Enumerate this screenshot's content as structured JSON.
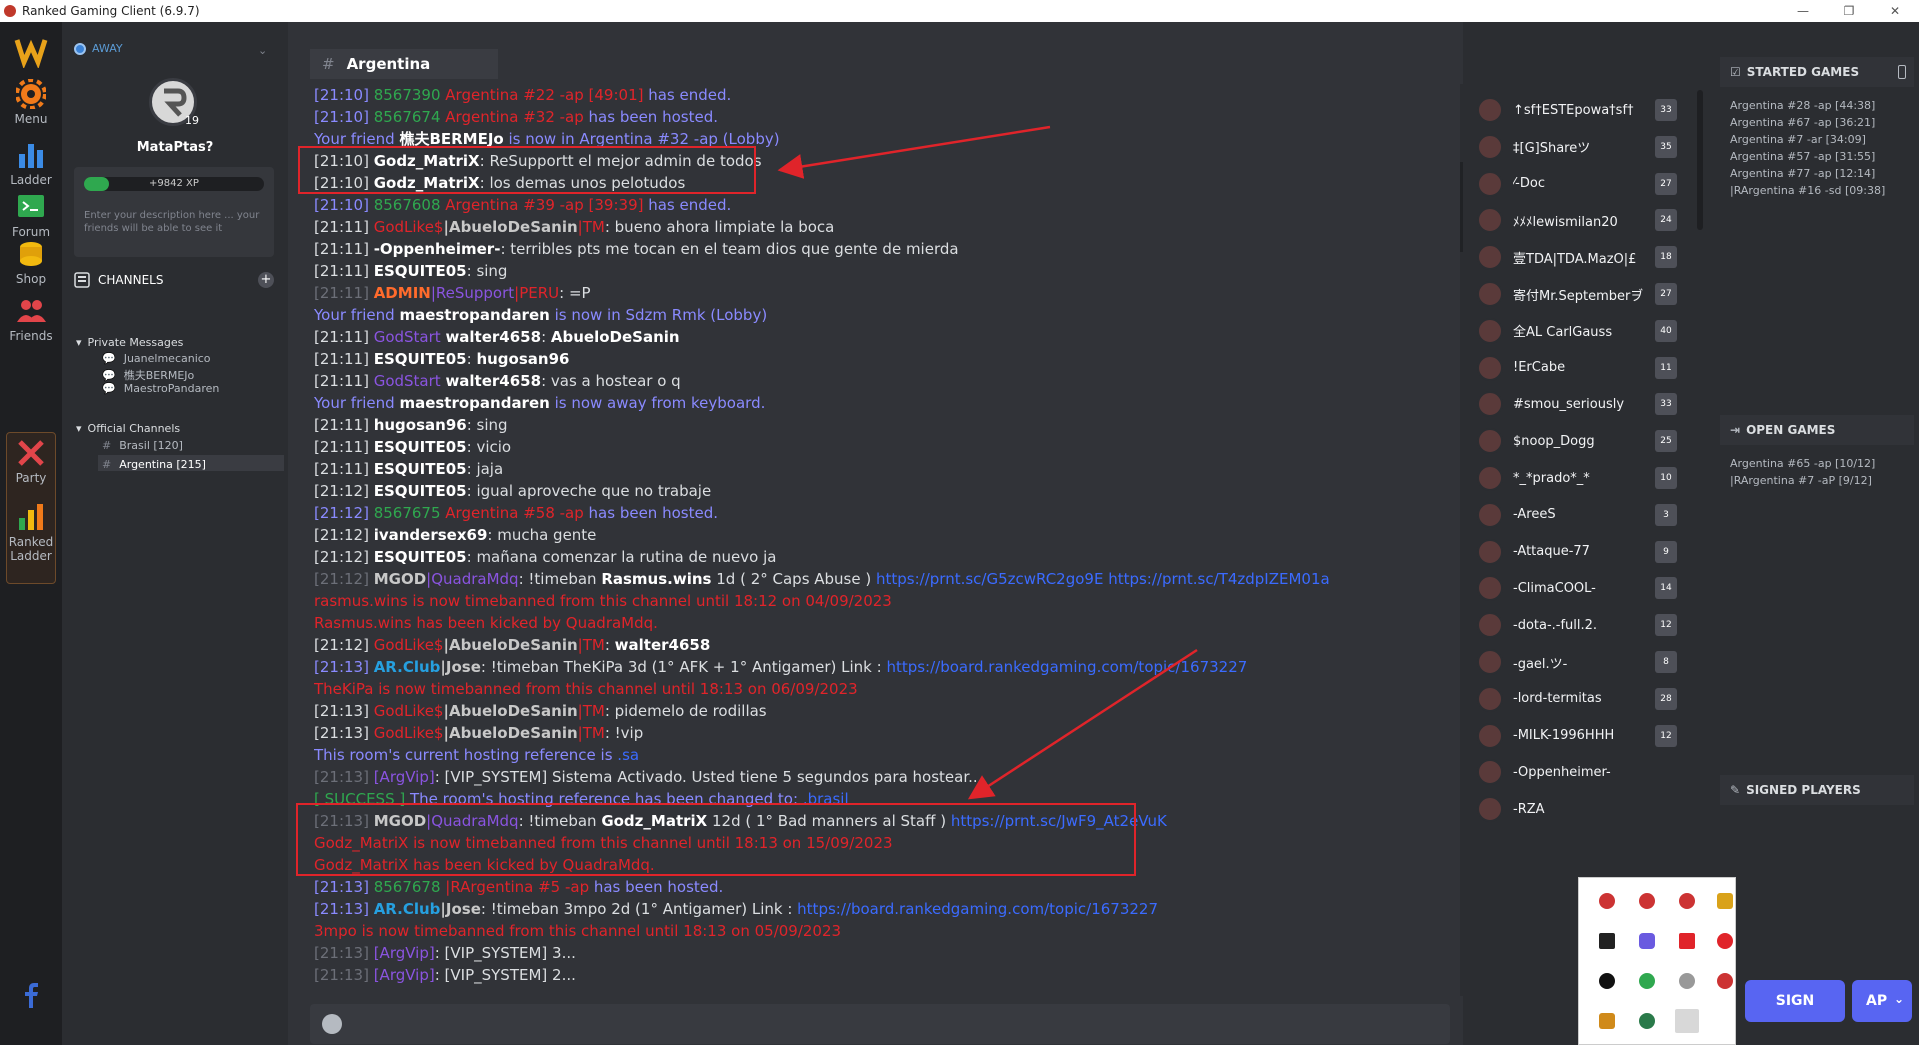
{
  "window": {
    "title": "Ranked Gaming Client (6.9.7)",
    "min": "—",
    "max": "❐",
    "close": "✕"
  },
  "rail": {
    "menu": "Menu",
    "ladder": "Ladder",
    "forum": "Forum",
    "shop": "Shop",
    "friends": "Friends",
    "party": "Party",
    "ranked_ladder_1": "Ranked",
    "ranked_ladder_2": "Ladder"
  },
  "profile": {
    "status": "AWAY",
    "level": "19",
    "username": "MataPtas?",
    "xp": "+9842 XP",
    "xp_fraction": 0.14,
    "description_placeholder": "Enter your description here ... your friends will be able to see it"
  },
  "channels": {
    "header": "CHANNELS",
    "private_group": "Private Messages",
    "private": [
      "Juanelmecanico",
      "樵夫BERMEJo",
      "MaestroPandaren"
    ],
    "official_group": "Official Channels",
    "official": [
      "Brasil [120]",
      "Argentina [215]"
    ]
  },
  "chat": {
    "channel": "Argentina",
    "messages": [
      [
        {
          "c": "blue",
          "t": "[21:10] "
        },
        {
          "c": "green",
          "t": "8567390 "
        },
        {
          "c": "red",
          "t": "Argentina #22 -ap [49:01]"
        },
        {
          "c": "blue",
          "t": " has ended."
        }
      ],
      [
        {
          "c": "blue",
          "t": "[21:10] "
        },
        {
          "c": "green",
          "t": "8567674 "
        },
        {
          "c": "red",
          "t": "Argentina #32 -ap"
        },
        {
          "c": "blue",
          "t": " has been hosted."
        }
      ],
      [
        {
          "c": "blue",
          "t": "Your friend "
        },
        {
          "c": "bold",
          "t": "樵夫BERMEJo"
        },
        {
          "c": "blue",
          "t": " is now in Argentina #32 -ap (Lobby)"
        }
      ],
      [
        {
          "c": "t",
          "t": "[21:10] "
        },
        {
          "c": "bold",
          "t": "Godz_MatriX"
        },
        {
          "c": "t",
          "t": ": ReSupportt el mejor admin de todos"
        }
      ],
      [
        {
          "c": "t",
          "t": "[21:10] "
        },
        {
          "c": "bold",
          "t": "Godz_MatriX"
        },
        {
          "c": "t",
          "t": ": los demas unos pelotudos"
        }
      ],
      [
        {
          "c": "blue",
          "t": "[21:10] "
        },
        {
          "c": "green",
          "t": "8567608 "
        },
        {
          "c": "red",
          "t": "Argentina #39 -ap [39:39]"
        },
        {
          "c": "blue",
          "t": " has ended."
        }
      ],
      [
        {
          "c": "t",
          "t": "[21:11] "
        },
        {
          "c": "red",
          "t": "GodLike$"
        },
        {
          "c": "gray-name",
          "t": "|AbueloDeSanin"
        },
        {
          "c": "red",
          "t": "|TM"
        },
        {
          "c": "t",
          "t": ": bueno ahora limpiate la boca"
        }
      ],
      [
        {
          "c": "t",
          "t": "[21:11] "
        },
        {
          "c": "bold",
          "t": "-Oppenheimer-"
        },
        {
          "c": "t",
          "t": ": terribles pts me tocan en el team dios que gente de mierda"
        }
      ],
      [
        {
          "c": "t",
          "t": "[21:11] "
        },
        {
          "c": "bold",
          "t": "ESQUITE05"
        },
        {
          "c": "t",
          "t": ": sing"
        }
      ],
      [
        {
          "c": "dim",
          "t": "[21:11] "
        },
        {
          "c": "orange",
          "t": "ADMIN"
        },
        {
          "c": "purple",
          "t": "|ReSupport"
        },
        {
          "c": "red",
          "t": "|PERU"
        },
        {
          "c": "t",
          "t": ": =P"
        }
      ],
      [
        {
          "c": "blue",
          "t": "Your friend "
        },
        {
          "c": "bold",
          "t": "maestropandaren"
        },
        {
          "c": "blue",
          "t": " is now in Sdzm Rmk (Lobby)"
        }
      ],
      [
        {
          "c": "t",
          "t": "[21:11] "
        },
        {
          "c": "purple",
          "t": "GodStart "
        },
        {
          "c": "bold",
          "t": "walter4658"
        },
        {
          "c": "t",
          "t": ": "
        },
        {
          "c": "bold",
          "t": "AbueloDeSanin"
        }
      ],
      [
        {
          "c": "t",
          "t": "[21:11] "
        },
        {
          "c": "bold",
          "t": "ESQUITE05"
        },
        {
          "c": "t",
          "t": ": "
        },
        {
          "c": "bold",
          "t": "hugosan96"
        }
      ],
      [
        {
          "c": "t",
          "t": "[21:11] "
        },
        {
          "c": "purple",
          "t": "GodStart "
        },
        {
          "c": "bold",
          "t": "walter4658"
        },
        {
          "c": "t",
          "t": ": vas a hostear o q"
        }
      ],
      [
        {
          "c": "blue",
          "t": "Your friend "
        },
        {
          "c": "bold",
          "t": "maestropandaren"
        },
        {
          "c": "blue",
          "t": " is now away from keyboard."
        }
      ],
      [
        {
          "c": "t",
          "t": "[21:11] "
        },
        {
          "c": "bold",
          "t": "hugosan96"
        },
        {
          "c": "t",
          "t": ": sing"
        }
      ],
      [
        {
          "c": "t",
          "t": "[21:11] "
        },
        {
          "c": "bold",
          "t": "ESQUITE05"
        },
        {
          "c": "t",
          "t": ": vicio"
        }
      ],
      [
        {
          "c": "t",
          "t": "[21:11] "
        },
        {
          "c": "bold",
          "t": "ESQUITE05"
        },
        {
          "c": "t",
          "t": ": jaja"
        }
      ],
      [
        {
          "c": "t",
          "t": "[21:12] "
        },
        {
          "c": "bold",
          "t": "ESQUITE05"
        },
        {
          "c": "t",
          "t": ": igual aproveche que no trabaje"
        }
      ],
      [
        {
          "c": "blue",
          "t": "[21:12] "
        },
        {
          "c": "green",
          "t": "8567675 "
        },
        {
          "c": "red",
          "t": "Argentina #58 -ap"
        },
        {
          "c": "blue",
          "t": " has been hosted."
        }
      ],
      [
        {
          "c": "t",
          "t": "[21:12] "
        },
        {
          "c": "bold",
          "t": "ivandersex69"
        },
        {
          "c": "t",
          "t": ": mucha gente"
        }
      ],
      [
        {
          "c": "t",
          "t": "[21:12] "
        },
        {
          "c": "bold",
          "t": "ESQUITE05"
        },
        {
          "c": "t",
          "t": ": mañana comenzar la rutina de nuevo ja"
        }
      ],
      [
        {
          "c": "dim",
          "t": "[21:12] "
        },
        {
          "c": "gray-name",
          "t": "MGOD"
        },
        {
          "c": "purple",
          "t": "|QuadraMdq"
        },
        {
          "c": "t",
          "t": ": !timeban "
        },
        {
          "c": "bold",
          "t": "Rasmus.wins"
        },
        {
          "c": "t",
          "t": " 1d ( 2° Caps Abuse ) "
        },
        {
          "c": "link",
          "t": "https://prnt.sc/G5zcwRC2go9E https://prnt.sc/T4zdpIZEM01a"
        }
      ],
      [
        {
          "c": "red",
          "t": "rasmus.wins is now timebanned from this channel until 18:12 on 04/09/2023"
        }
      ],
      [
        {
          "c": "red",
          "t": "Rasmus.wins has been kicked by QuadraMdq."
        }
      ],
      [
        {
          "c": "t",
          "t": "[21:12] "
        },
        {
          "c": "red",
          "t": "GodLike$"
        },
        {
          "c": "gray-name",
          "t": "|AbueloDeSanin"
        },
        {
          "c": "red",
          "t": "|TM"
        },
        {
          "c": "t",
          "t": ": "
        },
        {
          "c": "bold",
          "t": "walter4658"
        }
      ],
      [
        {
          "c": "blue",
          "t": "[21:13] "
        },
        {
          "c": "cyan",
          "t": "AR.Club"
        },
        {
          "c": "gray-name",
          "t": "|Jose"
        },
        {
          "c": "t",
          "t": ": !timeban TheKiPa  3d (1° AFK + 1° Antigamer) Link : "
        },
        {
          "c": "link",
          "t": "https://board.rankedgaming.com/topic/1673227"
        }
      ],
      [
        {
          "c": "red",
          "t": "TheKiPa is now timebanned from this channel until 18:13 on 06/09/2023"
        }
      ],
      [
        {
          "c": "t",
          "t": "[21:13] "
        },
        {
          "c": "red",
          "t": "GodLike$"
        },
        {
          "c": "gray-name",
          "t": "|AbueloDeSanin"
        },
        {
          "c": "red",
          "t": "|TM"
        },
        {
          "c": "t",
          "t": ": pidemelo de rodillas"
        }
      ],
      [
        {
          "c": "t",
          "t": "[21:13] "
        },
        {
          "c": "red",
          "t": "GodLike$"
        },
        {
          "c": "gray-name",
          "t": "|AbueloDeSanin"
        },
        {
          "c": "red",
          "t": "|TM"
        },
        {
          "c": "t",
          "t": ": !vip"
        }
      ],
      [
        {
          "c": "blue",
          "t": "This room's current hosting reference is "
        },
        {
          "c": "link",
          "t": ".sa"
        }
      ],
      [
        {
          "c": "dim",
          "t": "[21:13] "
        },
        {
          "c": "purple",
          "t": "[ArgVip]"
        },
        {
          "c": "t",
          "t": ": [VIP_SYSTEM] Sistema Activado. Usted tiene 5 segundos para hostear..."
        }
      ],
      [
        {
          "c": "green",
          "t": "[ SUCCESS ] "
        },
        {
          "c": "blue",
          "t": "The room's hosting reference has been changed to: "
        },
        {
          "c": "link",
          "t": ".brasil"
        }
      ],
      [
        {
          "c": "dim",
          "t": "[21:13] "
        },
        {
          "c": "gray-name",
          "t": "MGOD"
        },
        {
          "c": "purple",
          "t": "|QuadraMdq"
        },
        {
          "c": "t",
          "t": ": !timeban "
        },
        {
          "c": "bold",
          "t": "Godz_MatriX"
        },
        {
          "c": "t",
          "t": " 12d ( 1° Bad manners al Staff ) "
        },
        {
          "c": "link",
          "t": "https://prnt.sc/JwF9_At2eVuK"
        }
      ],
      [
        {
          "c": "red",
          "t": "Godz_MatriX is now timebanned from this channel until 18:13 on 15/09/2023"
        }
      ],
      [
        {
          "c": "red",
          "t": "Godz_MatriX has been kicked by QuadraMdq."
        }
      ],
      [
        {
          "c": "blue",
          "t": "[21:13] "
        },
        {
          "c": "green",
          "t": "8567678 "
        },
        {
          "c": "red",
          "t": "|RArgentina #5 -ap"
        },
        {
          "c": "blue",
          "t": " has been hosted."
        }
      ],
      [
        {
          "c": "blue",
          "t": "[21:13] "
        },
        {
          "c": "cyan",
          "t": "AR.Club"
        },
        {
          "c": "gray-name",
          "t": "|Jose"
        },
        {
          "c": "t",
          "t": ": !timeban 3mpo 2d (1° Antigamer) Link : "
        },
        {
          "c": "link",
          "t": "https://board.rankedgaming.com/topic/1673227"
        }
      ],
      [
        {
          "c": "red",
          "t": "3mpo is now timebanned from this channel until 18:13 on 05/09/2023"
        }
      ],
      [
        {
          "c": "dim",
          "t": "[21:13] "
        },
        {
          "c": "purple",
          "t": "[ArgVip]"
        },
        {
          "c": "t",
          "t": ": [VIP_SYSTEM] 3..."
        }
      ],
      [
        {
          "c": "dim",
          "t": "[21:13] "
        },
        {
          "c": "purple",
          "t": "[ArgVip]"
        },
        {
          "c": "t",
          "t": ": [VIP_SYSTEM] 2..."
        }
      ]
    ]
  },
  "members": [
    {
      "name": "↑sf†ESTEpowa†sf†",
      "lvl": "33"
    },
    {
      "name": "‡[G]Shareツ",
      "lvl": "35"
    },
    {
      "name": "⁄-Doc",
      "lvl": "27"
    },
    {
      "name": "ﾒﾒﾒlewismilan20",
      "lvl": "24"
    },
    {
      "name": "壹TDA|TDA.MazO|£",
      "lvl": "18"
    },
    {
      "name": "寄付Mr.Septemberヺ",
      "lvl": "27"
    },
    {
      "name": "全AL CarlGauss",
      "lvl": "40"
    },
    {
      "name": "!ErCabe",
      "lvl": "11"
    },
    {
      "name": "#smou_seriously",
      "lvl": "33"
    },
    {
      "name": "$noop_Dogg",
      "lvl": "25"
    },
    {
      "name": "*_*prado*_*",
      "lvl": "10"
    },
    {
      "name": "-AreeS",
      "lvl": "3"
    },
    {
      "name": "-Attaque-77",
      "lvl": "9"
    },
    {
      "name": "-ClimaCOOL-",
      "lvl": "14"
    },
    {
      "name": "-dota-.-full.2.",
      "lvl": "12"
    },
    {
      "name": "-gael.ツ-",
      "lvl": "8"
    },
    {
      "name": "-lord-termitas",
      "lvl": "28"
    },
    {
      "name": "-MILK-1996HHH",
      "lvl": "12"
    },
    {
      "name": "-Oppenheimer-",
      "lvl": ""
    },
    {
      "name": "-RZA",
      "lvl": ""
    }
  ],
  "games": {
    "started_header": "STARTED GAMES",
    "started": [
      "Argentina #28 -ap [44:38]",
      "Argentina #67 -ap [36:21]",
      "Argentina #7 -ar [34:09]",
      "Argentina #57 -ap [31:55]",
      "Argentina #77 -ap [12:14]",
      "|RArgentina #16 -sd [09:38]"
    ],
    "open_header": "OPEN GAMES",
    "open": [
      "Argentina #65 -ap [10/12]",
      "|RArgentina #7 -aP [9/12]"
    ],
    "signed_header": "SIGNED PLAYERS"
  },
  "buttons": {
    "sign": "SIGN",
    "ap": "AP",
    "ap_chevron": "⌄"
  },
  "colors": {
    "accent": "#5865f2",
    "annotation": "#e0242a",
    "status_away": "#3b82d6"
  }
}
